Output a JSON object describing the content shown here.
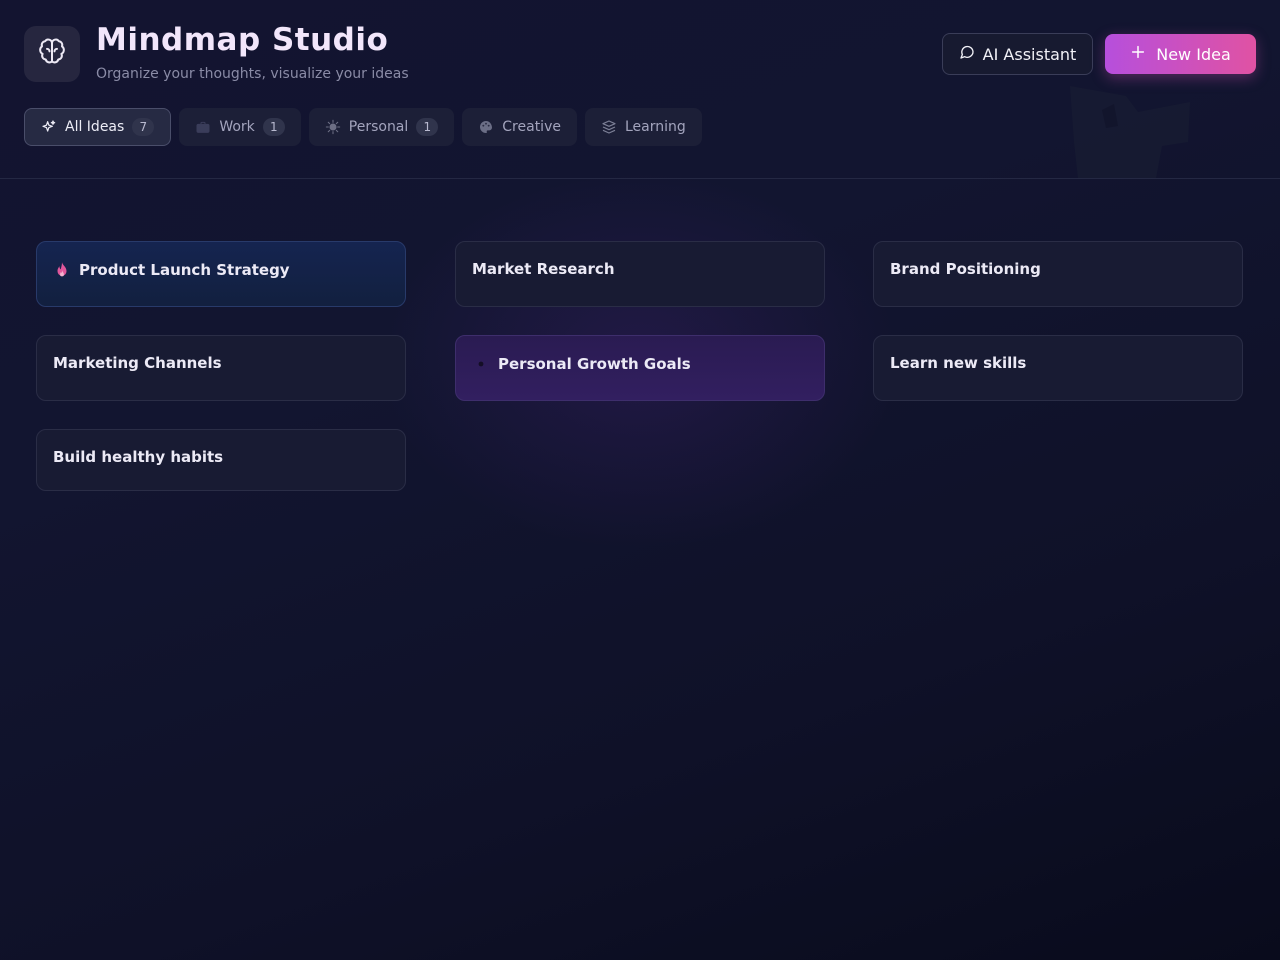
{
  "app": {
    "title": "Mindmap Studio",
    "subtitle": "Organize your thoughts, visualize your ideas",
    "logo_icon": "brain-icon"
  },
  "actions": {
    "ai_assistant": {
      "label": "AI Assistant",
      "icon": "chat-bubble-icon"
    },
    "new_idea": {
      "label": "New Idea",
      "icon": "plus-icon"
    }
  },
  "tabs": [
    {
      "label": "All Ideas",
      "count": "7",
      "icon": "sparkles-icon",
      "active": true
    },
    {
      "label": "Work",
      "count": "1",
      "icon": "briefcase-icon"
    },
    {
      "label": "Personal",
      "count": "1",
      "icon": "sun-icon"
    },
    {
      "label": "Creative",
      "icon": "palette-icon"
    },
    {
      "label": "Learning",
      "icon": "books-icon"
    }
  ],
  "ideas": [
    {
      "title": "Product Launch Strategy",
      "icon": "flame-icon",
      "style": "blue"
    },
    {
      "title": "Market Research"
    },
    {
      "title": "Brand Positioning"
    },
    {
      "title": "Marketing Channels"
    },
    {
      "title": "Personal Growth Goals",
      "icon": "dot-icon",
      "style": "purple"
    },
    {
      "title": "Learn new skills"
    },
    {
      "title": "Build healthy habits"
    }
  ],
  "colors": {
    "accent_gradient_start": "#b64fdc",
    "accent_gradient_end": "#e052a3",
    "background": "#121530",
    "title_text": "#f2e6fb"
  }
}
